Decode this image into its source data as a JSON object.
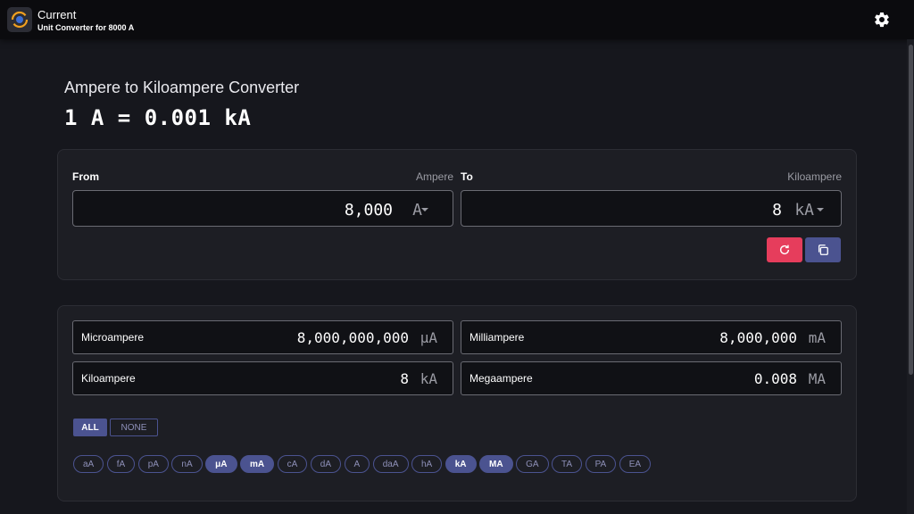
{
  "app": {
    "title": "Current",
    "subtitle": "Unit Converter for 8000 A"
  },
  "header": {
    "heading": "Ampere to Kiloampere Converter",
    "formula": "1 A = 0.001 kA"
  },
  "converter": {
    "from_label": "From",
    "from_unit_name": "Ampere",
    "from_value": "8,000",
    "from_unit": "A",
    "to_label": "To",
    "to_unit_name": "Kiloampere",
    "to_value": "8",
    "to_unit": "kA"
  },
  "results": [
    {
      "name": "Microampere",
      "value": "8,000,000,000",
      "unit": "μA"
    },
    {
      "name": "Milliampere",
      "value": "8,000,000",
      "unit": "mA"
    },
    {
      "name": "Kiloampere",
      "value": "8",
      "unit": "kA"
    },
    {
      "name": "Megaampere",
      "value": "0.008",
      "unit": "MA"
    }
  ],
  "toggles": {
    "all": "ALL",
    "none": "NONE"
  },
  "chips": [
    {
      "label": "aA",
      "on": false
    },
    {
      "label": "fA",
      "on": false
    },
    {
      "label": "pA",
      "on": false
    },
    {
      "label": "nA",
      "on": false
    },
    {
      "label": "μA",
      "on": true
    },
    {
      "label": "mA",
      "on": true
    },
    {
      "label": "cA",
      "on": false
    },
    {
      "label": "dA",
      "on": false
    },
    {
      "label": "A",
      "on": false
    },
    {
      "label": "daA",
      "on": false
    },
    {
      "label": "hA",
      "on": false
    },
    {
      "label": "kA",
      "on": true
    },
    {
      "label": "MA",
      "on": true
    },
    {
      "label": "GA",
      "on": false
    },
    {
      "label": "TA",
      "on": false
    },
    {
      "label": "PA",
      "on": false
    },
    {
      "label": "EA",
      "on": false
    }
  ],
  "colors": {
    "accent": "#4b5390",
    "danger": "#e63d5c",
    "background": "#16171d",
    "card": "#1d1e24"
  },
  "icons": {
    "app": "unit-converter-icon",
    "settings": "gear-icon",
    "reset": "refresh-icon",
    "copy": "copy-icon"
  }
}
